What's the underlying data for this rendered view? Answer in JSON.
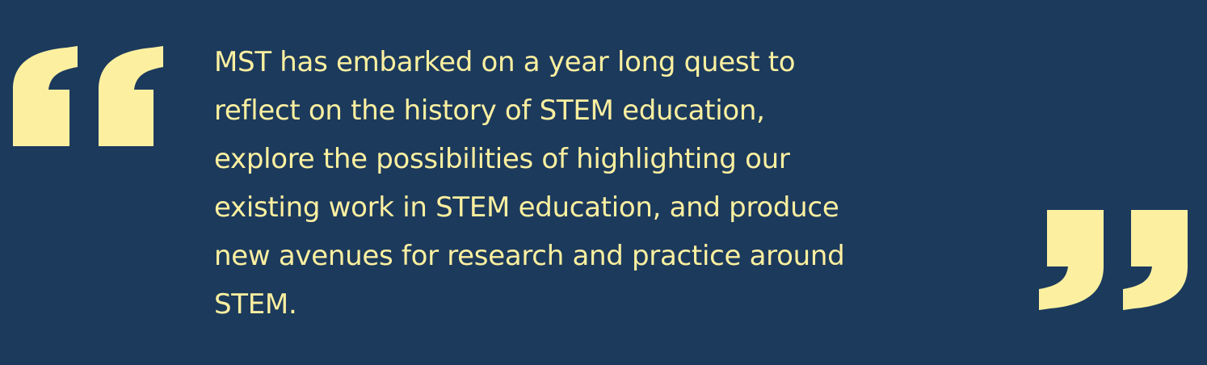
{
  "quote": {
    "lines": [
      "MST has embarked on a year long quest to",
      "reflect on the history of STEM education,",
      "explore the possibilities of highlighting our",
      "existing work in STEM education, and produce",
      "new avenues for research and practice around",
      "STEM."
    ],
    "open_icon": "open-quote-mark-icon",
    "close_icon": "close-quote-mark-icon"
  },
  "colors": {
    "background": "#1c3a5c",
    "accent": "#fcf0a0"
  }
}
